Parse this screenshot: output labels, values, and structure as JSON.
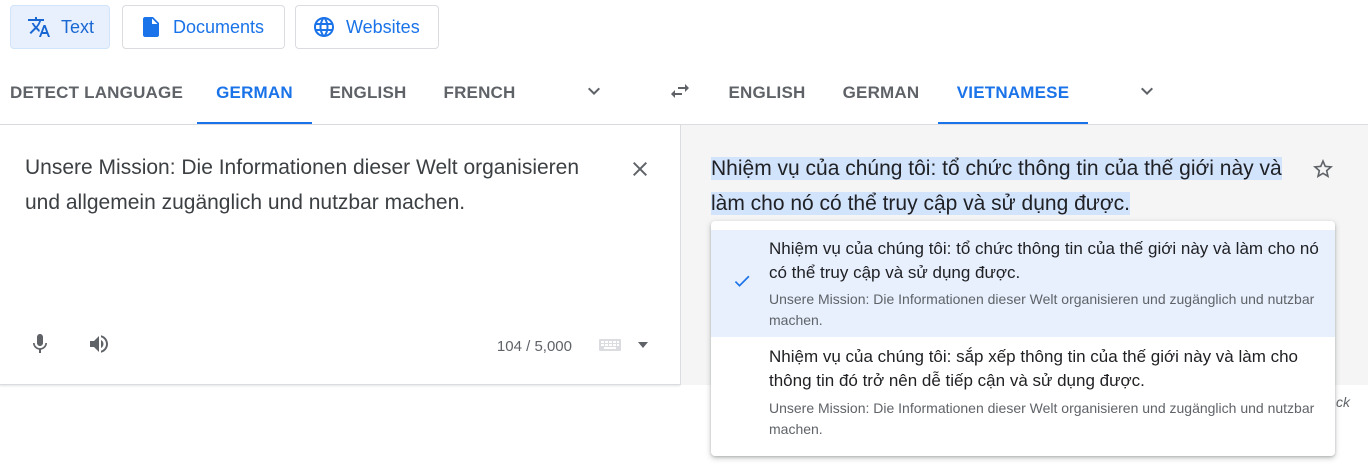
{
  "colors": {
    "accent": "#1a73e8",
    "selected_bg": "#e8f0fe",
    "highlight": "#d2e3fc",
    "icon_gray": "#5f6368"
  },
  "modes": [
    {
      "label": "Text",
      "icon": "translate-icon",
      "active": true
    },
    {
      "label": "Documents",
      "icon": "document-icon",
      "active": false
    },
    {
      "label": "Websites",
      "icon": "globe-icon",
      "active": false
    }
  ],
  "source_languages": [
    "DETECT LANGUAGE",
    "GERMAN",
    "ENGLISH",
    "FRENCH"
  ],
  "source_active": "GERMAN",
  "target_languages": [
    "ENGLISH",
    "GERMAN",
    "VIETNAMESE"
  ],
  "target_active": "VIETNAMESE",
  "icons": {
    "more_source": "chevron-down-icon",
    "swap": "swap-icon",
    "more_target": "chevron-down-icon",
    "clear": "close-icon",
    "mic": "microphone-icon",
    "speaker": "speaker-icon",
    "keyboard": "keyboard-icon",
    "save": "star-icon",
    "check": "check-icon"
  },
  "source": {
    "text": "Unsere Mission: Die Informationen dieser Welt organisieren und allgemein zugänglich und nutzbar machen.",
    "char_count": "104 / 5,000"
  },
  "target": {
    "text": "Nhiệm vụ của chúng tôi: tổ chức thông tin của thế giới này và làm cho nó có thể truy cập và sử dụng được.",
    "feedback_fragment": "ck"
  },
  "alternatives": [
    {
      "translation": "Nhiệm vụ của chúng tôi: tổ chức thông tin của thế giới này và làm cho nó có thể truy cập và sử dụng được.",
      "source": "Unsere Mission: Die Informationen dieser Welt organisieren und zugänglich und nutzbar machen.",
      "selected": true
    },
    {
      "translation": "Nhiệm vụ của chúng tôi: sắp xếp thông tin của thế giới này và làm cho thông tin đó trở nên dễ tiếp cận và sử dụng được.",
      "source": "Unsere Mission: Die Informationen dieser Welt organisieren und zugänglich und nutzbar machen.",
      "selected": false
    }
  ]
}
